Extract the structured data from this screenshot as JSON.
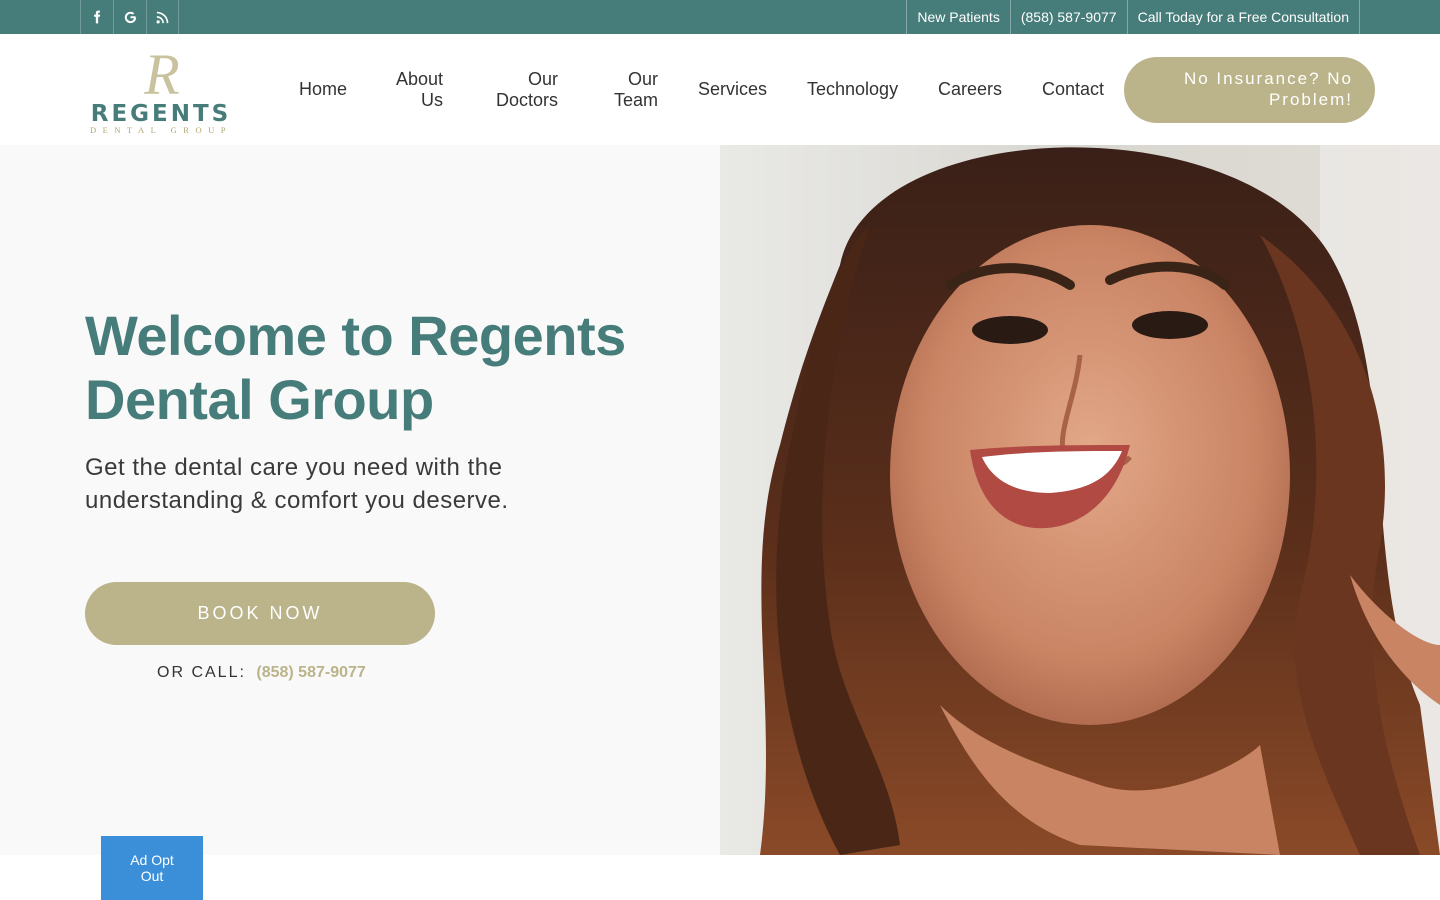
{
  "topbar": {
    "social": [
      {
        "icon": "facebook-icon"
      },
      {
        "icon": "google-icon"
      },
      {
        "icon": "blog-icon"
      }
    ],
    "links": [
      "New Patients",
      "(858) 587-9077",
      "Call Today for a Free Consultation"
    ]
  },
  "logo": {
    "monogram": "R",
    "name": "REGENTS",
    "tagline": "DENTAL GROUP"
  },
  "nav": {
    "home": "Home",
    "about_1": "About",
    "about_2": "Us",
    "doctors_1": "Our",
    "doctors_2": "Doctors",
    "team_1": "Our",
    "team_2": "Team",
    "services": "Services",
    "technology": "Technology",
    "careers": "Careers",
    "contact": "Contact",
    "cta_1": "No Insurance? No",
    "cta_2": "Problem!"
  },
  "hero": {
    "title_1": "Welcome to Regents",
    "title_2": "Dental Group",
    "subtitle_1": "Get the dental care you need with the",
    "subtitle_2": "understanding & comfort you deserve.",
    "book_label": "BOOK NOW",
    "or_call_label": "OR CALL:",
    "phone": "(858) 587-9077"
  },
  "ad_opt_out": {
    "line1": "Ad Opt",
    "line2": "Out"
  },
  "colors": {
    "brand_teal": "#467c79",
    "accent_gold": "#bbb38a",
    "ad_blue": "#3b8fd9"
  }
}
